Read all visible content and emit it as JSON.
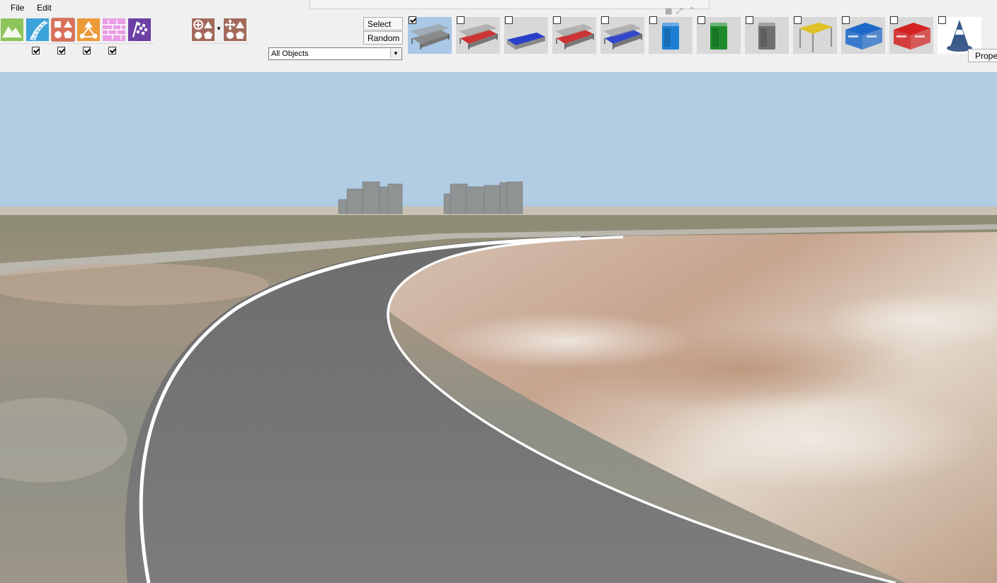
{
  "menu": {
    "file": "File",
    "edit": "Edit"
  },
  "toolbar": {
    "tools": [
      {
        "name": "terrain-tool",
        "color": "#7dbb4a"
      },
      {
        "name": "road-tool",
        "color": "#3a9fd6"
      },
      {
        "name": "objects-tool",
        "color": "#d9705a"
      },
      {
        "name": "nodes-tool",
        "color": "#e8922c"
      },
      {
        "name": "walls-tool",
        "color": "#e59ae0"
      },
      {
        "name": "checkered-tool",
        "color": "#6a3fa0"
      }
    ],
    "tool_checkboxes": [
      true,
      true,
      true,
      true
    ],
    "placement_tools": [
      {
        "name": "add-objects-tool",
        "color": "#a36a5c"
      },
      {
        "name": "move-objects-tool",
        "color": "#a36a5c"
      }
    ]
  },
  "selection": {
    "select_label": "Select",
    "random_label": "Random",
    "filter_value": "All Objects"
  },
  "objects": [
    {
      "name": "grandstand-empty",
      "checked": true,
      "selected": true,
      "icon": "grandstand",
      "color": "#888888"
    },
    {
      "name": "grandstand-red",
      "checked": false,
      "selected": false,
      "icon": "grandstand",
      "color": "#cc2a2a"
    },
    {
      "name": "grandstand-blue",
      "checked": false,
      "selected": false,
      "icon": "grandstand-low",
      "color": "#2a3fc9"
    },
    {
      "name": "grandstand-red-roof",
      "checked": false,
      "selected": false,
      "icon": "grandstand",
      "color": "#cc2a2a"
    },
    {
      "name": "grandstand-blue-roof",
      "checked": false,
      "selected": false,
      "icon": "grandstand",
      "color": "#2a3fc9"
    },
    {
      "name": "portable-toilet-blue",
      "checked": false,
      "selected": false,
      "icon": "toilet",
      "color": "#1c7fd3"
    },
    {
      "name": "portable-toilet-green",
      "checked": false,
      "selected": false,
      "icon": "toilet",
      "color": "#1f8a2c"
    },
    {
      "name": "portable-toilet-gray",
      "checked": false,
      "selected": false,
      "icon": "toilet",
      "color": "#707070"
    },
    {
      "name": "tent-yellow",
      "checked": false,
      "selected": false,
      "icon": "tent",
      "color": "#e0c128"
    },
    {
      "name": "tent-blue",
      "checked": false,
      "selected": false,
      "icon": "tent-walled",
      "color": "#1d68c9"
    },
    {
      "name": "tent-red",
      "checked": false,
      "selected": false,
      "icon": "tent-walled",
      "color": "#d42222"
    },
    {
      "name": "traffic-cone",
      "checked": false,
      "selected": false,
      "icon": "cone",
      "color": "#3a5a8a"
    }
  ],
  "properties_label": "Proper",
  "colors": {
    "sky": "#b1cce3",
    "road": "#6e6e6e",
    "road_edge": "#ffffff",
    "ground_sand": "#c9ae97",
    "ground_green": "#8a8b72"
  }
}
